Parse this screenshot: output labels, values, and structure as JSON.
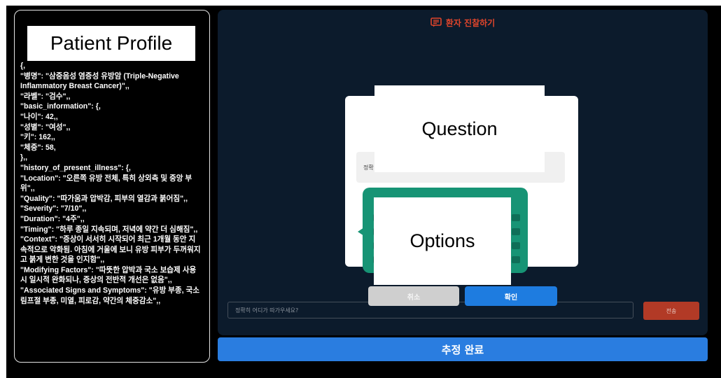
{
  "profile": {
    "title": "Patient Profile",
    "text": "{,\n\"병명\": \"삼중음성 염증성 유방암 (Triple-Negative Inflammatory Breast Cancer)\",,\n\"라벨\": \"검수\",,\n\"basic_information\": {,\n\"나이\": 42,,\n\"성별\": \"여성\",,\n\"키\": 162,,\n\"체중\": 58,\n},,\n\"history_of_present_illness\": {,\n\"Location\": \"오른쪽 유방 전체, 특히 상외측 및 중앙 부위\",,\n\"Quality\": \"따가움과 압박감, 피부의 열감과 붉어짐\",,\n\"Severity\": \"7/10\",,\n\"Duration\": \"4주\",,\n\"Timing\": \"하루 종일 지속되며, 저녁에 약간 더 심해짐\",,\n\"Context\": \"증상이 서서히 시작되어 최근 1개월 동안 지속적으로 악화됨. 아침에 거울에 보니 유방 피부가 두꺼워지고 붉게 변한 것을 인지함\",,\n\"Modifying Factors\": \"따뜻한 압박과 국소 보습제 사용 시 일시적 완화되나, 증상의 전반적 개선은 없음\",,\n\"Associated Signs and Symptoms\": \"유방 부종, 국소 림프절 부종, 미열, 피로감, 약간의 체중감소\",,"
  },
  "chat": {
    "header_title": "환자 진찰하기",
    "input_value": "정확히 어디가 따가우세요?",
    "send_label": "전송"
  },
  "modal": {
    "field_prefix": "정확",
    "question_overlay": "Question",
    "options_overlay": "Options",
    "cancel_label": "취소",
    "confirm_label": "확인"
  },
  "footer": {
    "finish_label": "추정 완료"
  },
  "colors": {
    "accent_red": "#e0452b",
    "panel_navy": "#0c1b2c",
    "primary_blue": "#2a7de0",
    "options_green": "#179475"
  }
}
